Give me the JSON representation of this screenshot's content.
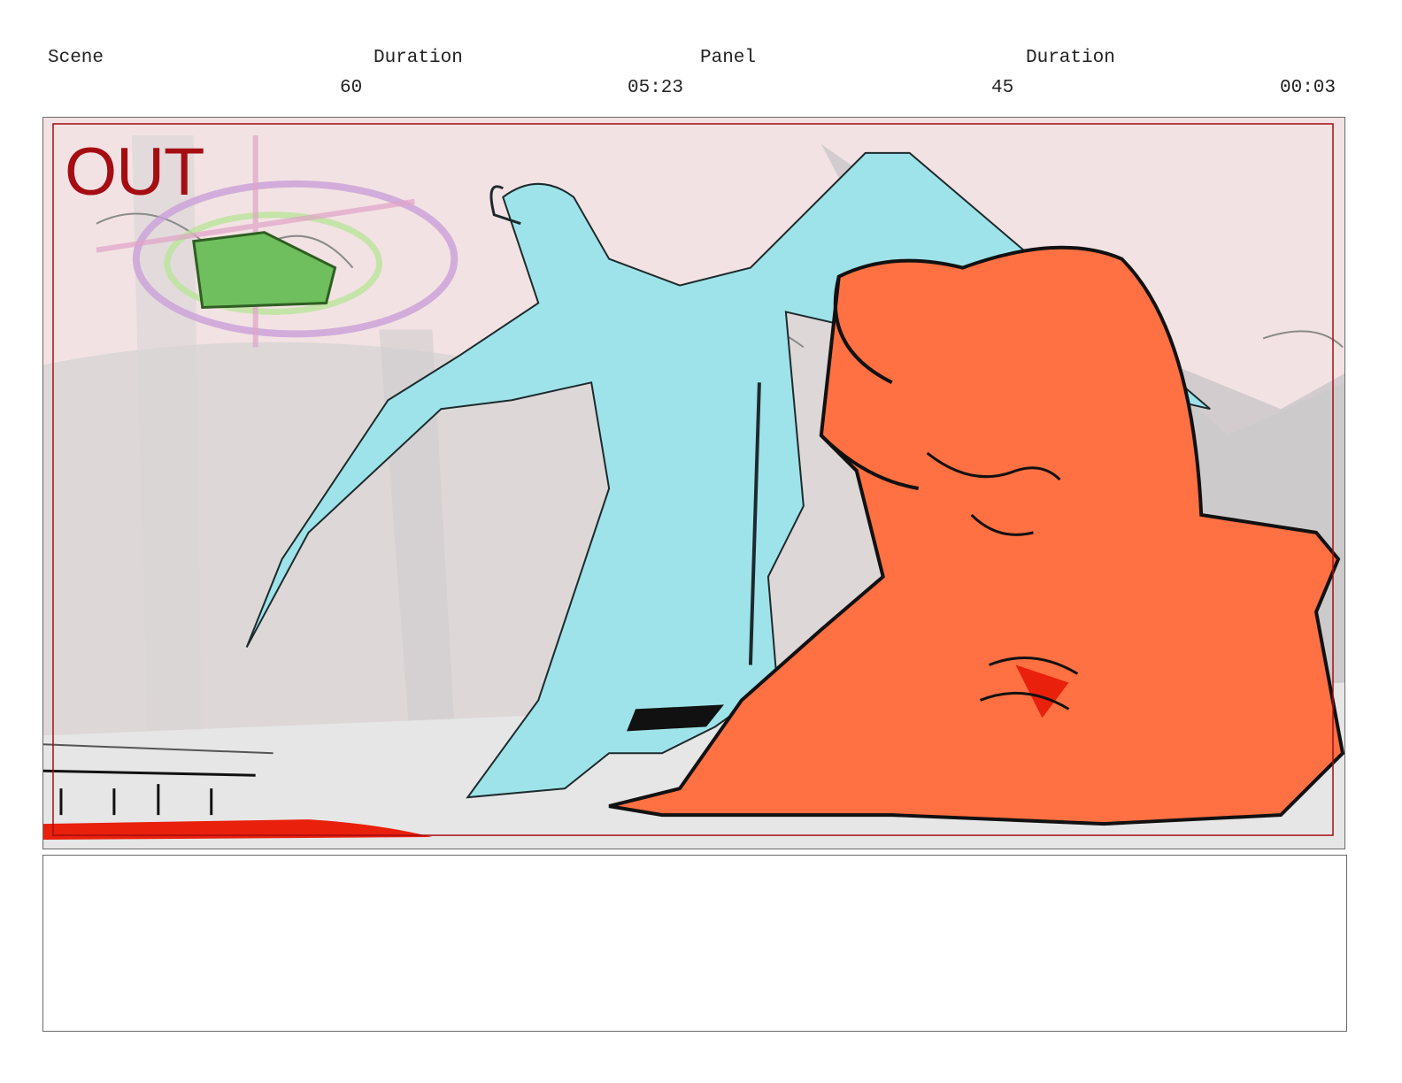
{
  "header": {
    "scene_label": "Scene",
    "duration_label_1": "Duration",
    "panel_label": "Panel",
    "duration_label_2": "Duration",
    "scene_value": "60",
    "scene_duration": "05:23",
    "panel_value": "45",
    "panel_duration": "00:03"
  },
  "panel": {
    "overlay_text": "OUT",
    "colors": {
      "background": "#f2dfe0",
      "safe_frame": "#a50d12",
      "left_character": "#9fe3ea",
      "right_character": "#ff7043",
      "book": "#6fbf5e",
      "blood": "#e8200c"
    }
  },
  "notes": {
    "text": ""
  }
}
